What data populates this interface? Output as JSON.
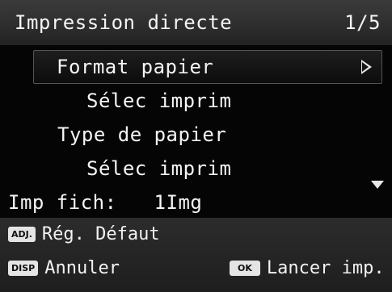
{
  "header": {
    "title": "Impression directe",
    "page": "1/5"
  },
  "menu": {
    "items": [
      {
        "label": "Format papier",
        "selected": true,
        "has_submenu_arrow": true
      },
      {
        "label": "Sélec imprim"
      },
      {
        "label": "Type de papier"
      },
      {
        "label": "Sélec imprim"
      }
    ],
    "info": {
      "label": "Imp fich:",
      "value": "1Img"
    },
    "more_below_indicator": "chevron-down"
  },
  "footer": {
    "adj": {
      "badge": "ADJ.",
      "label": "Rég. Défaut"
    },
    "disp": {
      "badge": "DISP",
      "label": "Annuler"
    },
    "ok": {
      "badge": "OK",
      "label": "Lancer imp."
    }
  },
  "colors": {
    "background": "#050505",
    "header_bg": "#2e2e2e",
    "footer_bg": "#262626",
    "text": "#f4f4f4",
    "badge_bg": "#e4e4e4"
  }
}
